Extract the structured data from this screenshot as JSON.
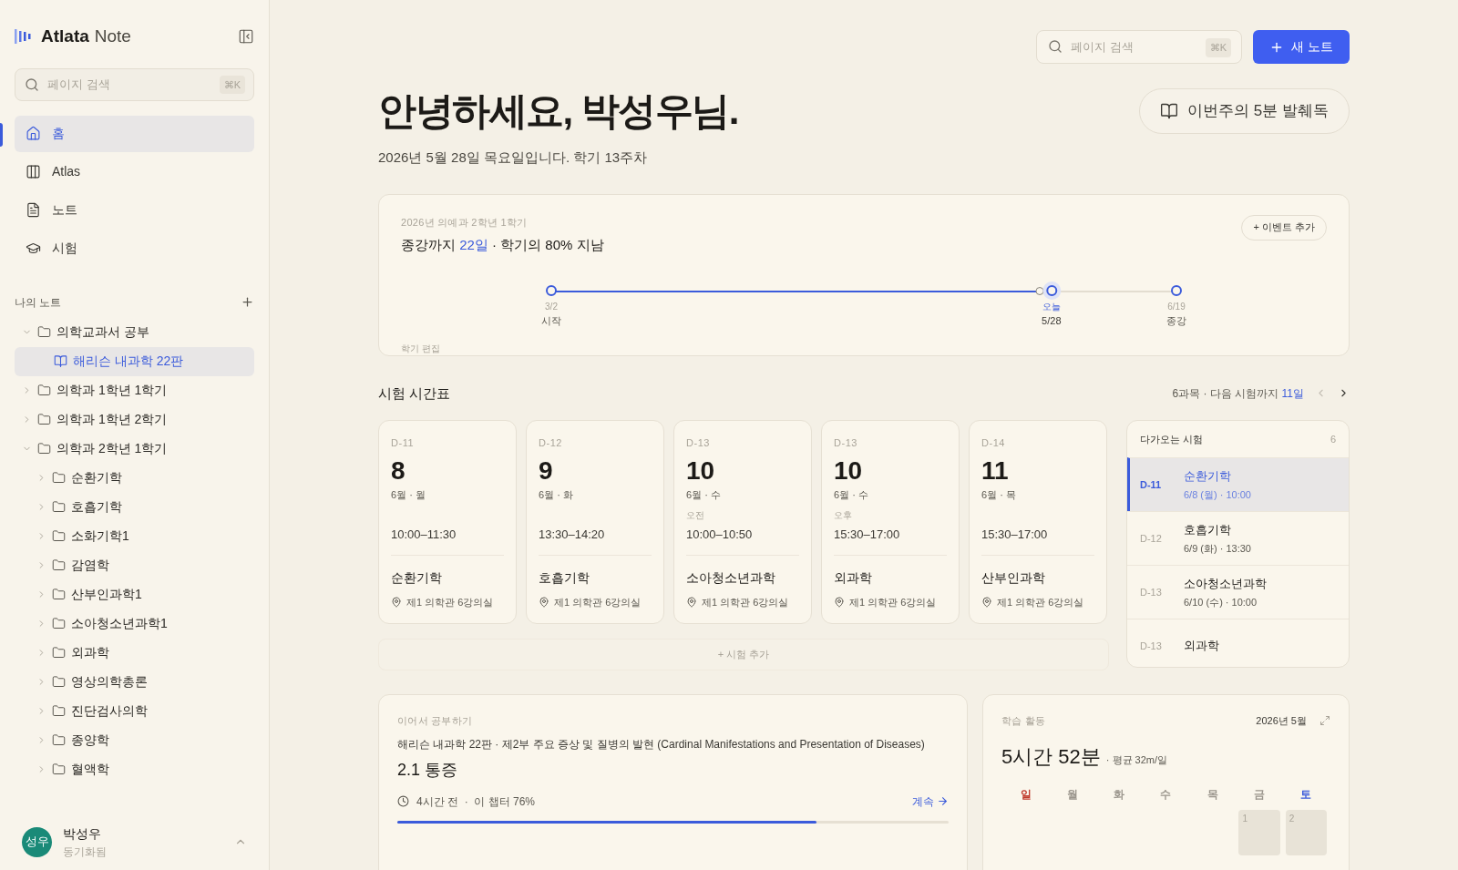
{
  "sidebar": {
    "brand": {
      "name": "Atlata",
      "suffix": "Note"
    },
    "search": {
      "placeholder": "페이지 검색",
      "shortcut": "⌘K"
    },
    "nav": [
      {
        "label": "홈",
        "selected": true
      },
      {
        "label": "Atlas",
        "selected": false
      },
      {
        "label": "노트",
        "selected": false
      },
      {
        "label": "시험",
        "selected": false
      }
    ],
    "section_title": "나의 노트",
    "tree": [
      {
        "kind": "folder",
        "label": "의학교과서 공부",
        "expanded": true,
        "selected": false,
        "children": [
          {
            "kind": "book",
            "label": "해리슨 내과학 22판",
            "selected": true
          }
        ]
      },
      {
        "kind": "folder",
        "label": "의학과 1학년 1학기",
        "expanded": false,
        "selected": false
      },
      {
        "kind": "folder",
        "label": "의학과 1학년 2학기",
        "expanded": false,
        "selected": false
      },
      {
        "kind": "folder",
        "label": "의학과 2학년 1학기",
        "expanded": true,
        "selected": false,
        "children": [
          {
            "kind": "folder",
            "label": "순환기학",
            "expanded": false,
            "selected": false
          },
          {
            "kind": "folder",
            "label": "호흡기학",
            "expanded": false,
            "selected": false
          },
          {
            "kind": "folder",
            "label": "소화기학1",
            "expanded": false,
            "selected": false
          },
          {
            "kind": "folder",
            "label": "감염학",
            "expanded": false,
            "selected": false
          },
          {
            "kind": "folder",
            "label": "산부인과학1",
            "expanded": false,
            "selected": false
          },
          {
            "kind": "folder",
            "label": "소아청소년과학1",
            "expanded": false,
            "selected": false
          },
          {
            "kind": "folder",
            "label": "외과학",
            "expanded": false,
            "selected": false
          },
          {
            "kind": "folder",
            "label": "영상의학총론",
            "expanded": false,
            "selected": false
          },
          {
            "kind": "folder",
            "label": "진단검사의학",
            "expanded": false,
            "selected": false
          },
          {
            "kind": "folder",
            "label": "종양학",
            "expanded": false,
            "selected": false
          },
          {
            "kind": "folder",
            "label": "혈액학",
            "expanded": false,
            "selected": false
          }
        ]
      }
    ],
    "user": {
      "initials": "성우",
      "name": "박성우",
      "status": "동기화됨"
    }
  },
  "header": {
    "search": {
      "placeholder": "페이지 검색",
      "shortcut": "⌘K"
    },
    "new_button": "새 노트",
    "greeting": "안녕하세요, 박성우님.",
    "subtitle": "2026년 5월 28일 목요일입니다. 학기 13주차",
    "digest_button": "이번주의 5분 발췌독"
  },
  "semester": {
    "caption": "2026년 의예과 2학년 1학기",
    "headline": "종강까지 **22일** · 학기의 80% 지남",
    "add_event": "+ 이벤트 추가",
    "level": 0.8,
    "points": [
      {
        "kind": "start",
        "date": "3/2",
        "label": "시작"
      },
      {
        "kind": "marker"
      },
      {
        "kind": "today",
        "date": "오늘",
        "label": "5/28"
      },
      {
        "kind": "end",
        "date": "6/19",
        "label": "종강"
      }
    ],
    "edit_link": "학기 편집"
  },
  "exams": {
    "title": "시험 시간표",
    "summary": "6과목 · 다음 시험까지 **11일**",
    "cards": [
      {
        "dday": "D-11",
        "day": "8",
        "date": "6월 · 월",
        "time": "10:00–11:30",
        "subject": "순환기학",
        "location": "제1 의학관 6강의실"
      },
      {
        "dday": "D-12",
        "day": "9",
        "date": "6월 · 화",
        "time": "13:30–14:20",
        "subject": "호흡기학",
        "location": "제1 의학관 6강의실"
      },
      {
        "dday": "D-13",
        "day": "10",
        "date": "6월 · 수",
        "period": "오전",
        "time": "10:00–10:50",
        "subject": "소아청소년과학",
        "location": "제1 의학관 6강의실"
      },
      {
        "dday": "D-13",
        "day": "10",
        "date": "6월 · 수",
        "period": "오후",
        "time": "15:30–17:00",
        "subject": "외과학",
        "location": "제1 의학관 6강의실"
      },
      {
        "dday": "D-14",
        "day": "11",
        "date": "6월 · 목",
        "time": "15:30–17:00",
        "subject": "산부인과학",
        "location": "제1 의학관 6강의실"
      }
    ],
    "add_exam": "+ 시험 추가",
    "upcoming": {
      "title": "다가오는 시험",
      "count": "6",
      "items": [
        {
          "dday": "D-11",
          "name": "순환기학",
          "date": "6/8 (월) · 10:00",
          "selected": true
        },
        {
          "dday": "D-12",
          "name": "호흡기학",
          "date": "6/9 (화) · 13:30",
          "selected": false
        },
        {
          "dday": "D-13",
          "name": "소아청소년과학",
          "date": "6/10 (수) · 10:00",
          "selected": false
        },
        {
          "dday": "D-13",
          "name": "외과학",
          "selected": false
        }
      ]
    }
  },
  "continue": {
    "caption": "이어서 공부하기",
    "source": "해리슨 내과학 22판 · 제2부 주요 증상 및 질병의 발현 (Cardinal Manifestations and Presentation of Diseases)",
    "title": "2.1 통증",
    "meta": "4시간 전  ·  이 챕터 76%",
    "link": "계속",
    "level": 0.76
  },
  "activity": {
    "caption": "학습 활동",
    "month": "2026년 5월",
    "total": "5시간 52분",
    "average": "· 평균 32m/일",
    "weekdays": [
      {
        "label": "일",
        "color": "#c0392b"
      },
      {
        "label": "월",
        "color": "#9a958c"
      },
      {
        "label": "화",
        "color": "#9a958c"
      },
      {
        "label": "수",
        "color": "#9a958c"
      },
      {
        "label": "목",
        "color": "#9a958c"
      },
      {
        "label": "금",
        "color": "#9a958c"
      },
      {
        "label": "토",
        "color": "#3b5bdb"
      }
    ],
    "days": [
      "1",
      "2"
    ]
  }
}
